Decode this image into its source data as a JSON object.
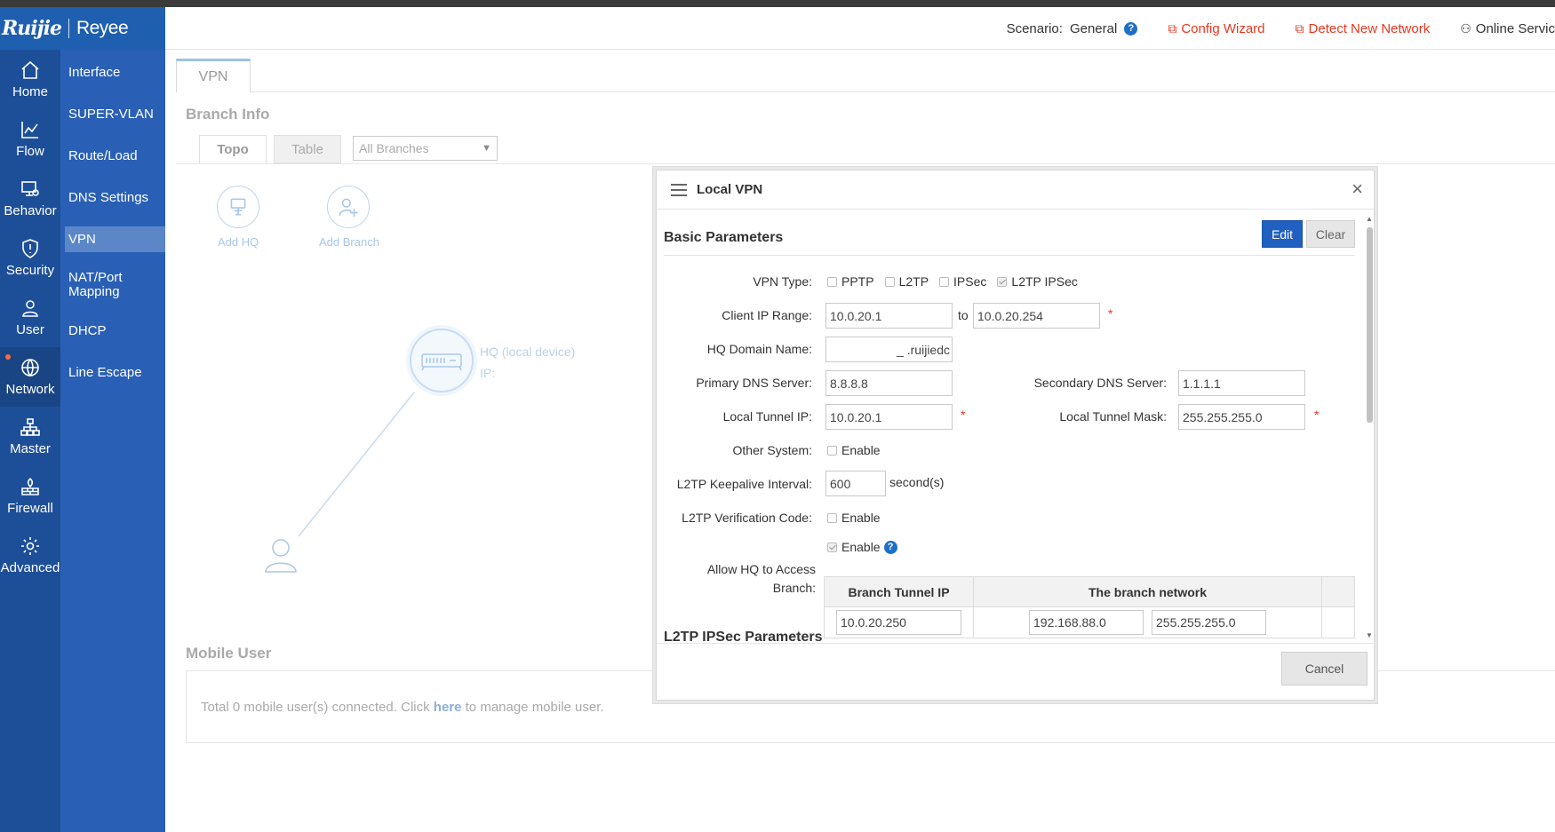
{
  "header": {
    "logo_main": "Ruijie",
    "logo_sub": "Reyee",
    "scenario_label": "Scenario:",
    "scenario_value": "General",
    "scenario_help": "?",
    "config_wizard": "Config Wizard",
    "detect_network": "Detect New Network",
    "online_service": "Online Servic"
  },
  "sidenav": {
    "items": [
      {
        "label": "Home",
        "icon": "home-icon"
      },
      {
        "label": "Flow",
        "icon": "chart-line-icon"
      },
      {
        "label": "Behavior",
        "icon": "monitor-icon"
      },
      {
        "label": "Security",
        "icon": "shield-icon"
      },
      {
        "label": "User",
        "icon": "user-icon"
      },
      {
        "label": "Network",
        "icon": "globe-icon"
      },
      {
        "label": "Master",
        "icon": "hierarchy-icon"
      },
      {
        "label": "Firewall",
        "icon": "firewall-icon"
      },
      {
        "label": "Advanced",
        "icon": "gear-icon"
      }
    ]
  },
  "subnav": {
    "items": [
      "Interface",
      "SUPER-VLAN",
      "Route/Load",
      "DNS Settings",
      "VPN",
      "NAT/Port Mapping",
      "DHCP",
      "Line Escape"
    ]
  },
  "main": {
    "tab": "VPN",
    "branch_info_title": "Branch Info",
    "subtabs": [
      "Topo",
      "Table"
    ],
    "branch_select": "All Branches",
    "add_hq": "Add HQ",
    "add_branch": "Add Branch",
    "hq_label": "HQ (local device)",
    "hq_ip_label": "IP:",
    "mobile_title": "Mobile User",
    "mobile_text_pre": "Total 0 mobile user(s) connected. Click",
    "mobile_link": "here",
    "mobile_text_post": "to manage mobile user."
  },
  "modal": {
    "title": "Local VPN",
    "close": "×",
    "basic_title": "Basic Parameters",
    "edit": "Edit",
    "clear": "Clear",
    "vpn_type_label": "VPN Type:",
    "vpn_types": [
      {
        "label": "PPTP",
        "checked": false
      },
      {
        "label": "L2TP",
        "checked": false
      },
      {
        "label": "IPSec",
        "checked": false
      },
      {
        "label": "L2TP IPSec",
        "checked": true
      }
    ],
    "client_ip_label": "Client IP Range:",
    "client_ip_from": "10.0.20.1",
    "client_ip_to_word": "to",
    "client_ip_to": "10.0.20.254",
    "required_mark": "*",
    "hq_domain_label": "HQ Domain Name:",
    "hq_domain_value": "_  .ruijiedc",
    "primary_dns_label": "Primary DNS Server:",
    "primary_dns": "8.8.8.8",
    "secondary_dns_label": "Secondary DNS Server:",
    "secondary_dns": "1.1.1.1",
    "local_tunnel_ip_label": "Local Tunnel IP:",
    "local_tunnel_ip": "10.0.20.1",
    "local_tunnel_mask_label": "Local Tunnel Mask:",
    "local_tunnel_mask": "255.255.255.0",
    "other_system_label": "Other System:",
    "enable": "Enable",
    "keepalive_label": "L2TP Keepalive Interval:",
    "keepalive_value": "600",
    "keepalive_unit": "second(s)",
    "verification_label": "L2TP Verification Code:",
    "allow_hq_label": "Allow HQ to Access Branch:",
    "allow_help": "?",
    "table": {
      "headers": [
        "Branch Tunnel IP",
        "The branch network"
      ],
      "row": {
        "tunnel_ip": "10.0.20.250",
        "network": "192.168.88.0",
        "mask": "255.255.255.0"
      }
    },
    "ipsec_title": "L2TP IPSec Parameters",
    "cancel": "Cancel"
  }
}
